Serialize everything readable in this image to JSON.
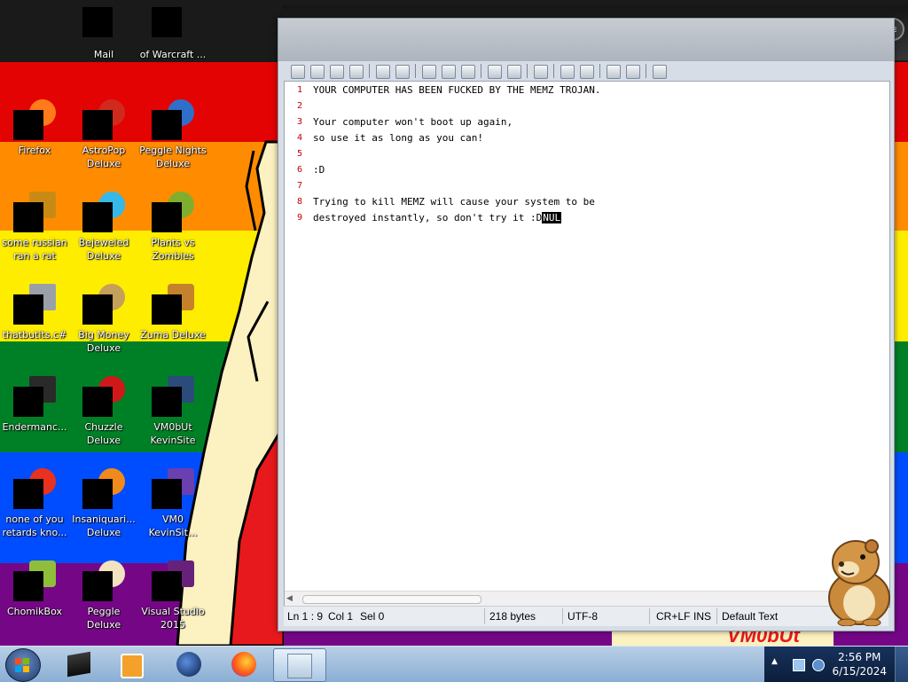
{
  "desktop": {
    "icons": [
      {
        "label": "Mail"
      },
      {
        "label": "of Warcraft ..."
      },
      {
        "label": "Firefox"
      },
      {
        "label": "AstroPop Deluxe"
      },
      {
        "label": "Peggle Nights Deluxe"
      },
      {
        "label": "some russian ran a rat"
      },
      {
        "label": "Bejeweled Deluxe"
      },
      {
        "label": "Plants vs Zombies"
      },
      {
        "label": "thatbutits.c#"
      },
      {
        "label": "Big Money Deluxe"
      },
      {
        "label": "Zuma Deluxe"
      },
      {
        "label": "Endermanc..."
      },
      {
        "label": "Chuzzle Deluxe"
      },
      {
        "label": "VM0bUt KevinSite"
      },
      {
        "label": "none of you retards kno..."
      },
      {
        "label": "Insaniquari... Deluxe"
      },
      {
        "label": "VM0 KevinSit..."
      },
      {
        "label": "ChomikBox"
      },
      {
        "label": "Peggle Deluxe"
      },
      {
        "label": "Visual Studio 2015"
      }
    ],
    "watermark": "VM0bUt"
  },
  "editor": {
    "lines": [
      {
        "num": "1",
        "text": "YOUR COMPUTER HAS BEEN FUCKED BY THE MEMZ TROJAN."
      },
      {
        "num": "2",
        "text": ""
      },
      {
        "num": "3",
        "text": "Your computer won't boot up again,"
      },
      {
        "num": "4",
        "text": "so use it as long as you can!"
      },
      {
        "num": "5",
        "text": ""
      },
      {
        "num": "6",
        "text": ":D"
      },
      {
        "num": "7",
        "text": ""
      },
      {
        "num": "8",
        "text": "Trying to kill MEMZ will cause your system to be"
      },
      {
        "num": "9",
        "text": "destroyed instantly, so don't try it :D",
        "tail": "NUL"
      }
    ],
    "status": {
      "position": "Ln 1 : 9",
      "col": "Col 1",
      "sel": "Sel 0",
      "size": "218 bytes",
      "encoding": "UTF-8",
      "eol": "CR+LF",
      "mode": "INS",
      "lexer": "Default Text"
    }
  },
  "dock": {
    "items": [
      "apps-icon",
      "world-icon",
      "internet-explorer-icon",
      "mail-icon",
      "users-icon"
    ]
  },
  "taskbar": {
    "clock_time": "2:56 PM",
    "clock_date": "6/15/2024",
    "tray_arrow": "▲"
  },
  "colors": {
    "stripe_red": "#e40303",
    "stripe_orange": "#ff8c00",
    "stripe_yellow": "#ffed00",
    "stripe_green": "#008026",
    "stripe_blue": "#004dff",
    "stripe_purple": "#750787",
    "line_number": "#c00000"
  }
}
